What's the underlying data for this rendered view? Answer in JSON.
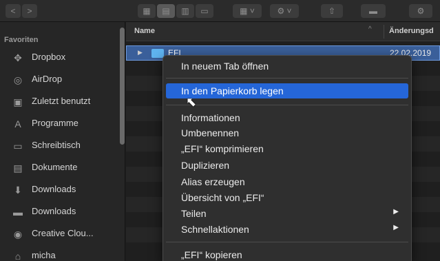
{
  "toolbar": {
    "back_icon": "<",
    "forward_icon": ">",
    "view_icons": "▦",
    "view_list": "▤",
    "view_columns": "▥",
    "view_gallery": "▭",
    "group_icon": "▦ ˅",
    "action_icon": "⚙ ˅",
    "share_icon": "⇧",
    "tag_icon": "▬",
    "settings_icon": "⚙"
  },
  "sidebar": {
    "heading": "Favoriten",
    "items": [
      {
        "label": "Dropbox",
        "icon": "✥"
      },
      {
        "label": "AirDrop",
        "icon": "◎"
      },
      {
        "label": "Zuletzt benutzt",
        "icon": "▣"
      },
      {
        "label": "Programme",
        "icon": "A"
      },
      {
        "label": "Schreibtisch",
        "icon": "▭"
      },
      {
        "label": "Dokumente",
        "icon": "▤"
      },
      {
        "label": "Downloads",
        "icon": "⬇"
      },
      {
        "label": "Downloads",
        "icon": "▬"
      },
      {
        "label": "Creative Clou...",
        "icon": "◉"
      },
      {
        "label": "micha",
        "icon": "⌂"
      }
    ]
  },
  "list": {
    "col_name": "Name",
    "sort_icon": "^",
    "col_date": "Änderungsd",
    "selected_file": {
      "disclosure": "▶",
      "name": "EFI",
      "date": "22.02.2019"
    }
  },
  "context_menu": {
    "items": [
      {
        "label": "In neuem Tab öffnen",
        "group": 1
      },
      {
        "label": "In den Papierkorb legen",
        "group": 2,
        "highlighted": true
      },
      {
        "label": "Informationen",
        "group": 3
      },
      {
        "label": "Umbenennen",
        "group": 3
      },
      {
        "label": "„EFI“ komprimieren",
        "group": 3
      },
      {
        "label": "Duplizieren",
        "group": 3
      },
      {
        "label": "Alias erzeugen",
        "group": 3
      },
      {
        "label": "Übersicht von „EFI“",
        "group": 3
      },
      {
        "label": "Teilen",
        "group": 3,
        "submenu": true
      },
      {
        "label": "Schnellaktionen",
        "group": 3,
        "submenu": true
      },
      {
        "label": "„EFI“ kopieren",
        "group": 4
      }
    ],
    "submenu_arrow": "▶",
    "highlight_color": "#2566d8"
  },
  "cursor_icon": "⬉"
}
